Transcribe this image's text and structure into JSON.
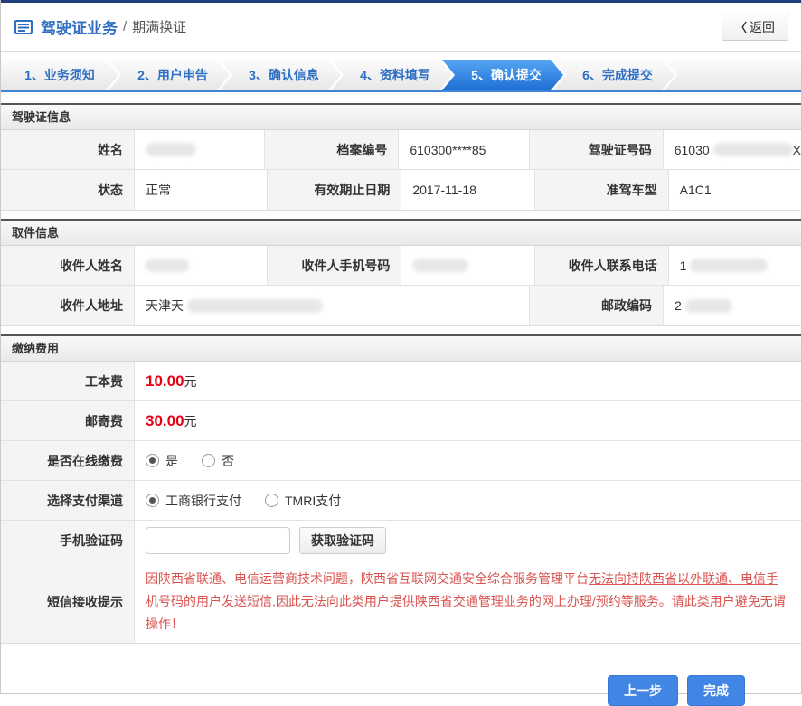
{
  "header": {
    "title": "驾驶证业务",
    "separator": "/",
    "subtitle": "期满换证",
    "back_icon": "〈",
    "back_label": "返回"
  },
  "steps": [
    {
      "label": "1、业务须知",
      "active": false
    },
    {
      "label": "2、用户申告",
      "active": false
    },
    {
      "label": "3、确认信息",
      "active": false
    },
    {
      "label": "4、资料填写",
      "active": false
    },
    {
      "label": "5、确认提交",
      "active": true
    },
    {
      "label": "6、完成提交",
      "active": false
    }
  ],
  "sections": {
    "license": {
      "title": "驾驶证信息",
      "rows": [
        [
          {
            "label": "姓名",
            "value": "",
            "redacted": true
          },
          {
            "label": "档案编号",
            "value": "610300****85"
          },
          {
            "label": "驾驶证号码",
            "value_prefix": "61030",
            "value_suffix": "X",
            "redacted": true
          }
        ],
        [
          {
            "label": "状态",
            "value": "正常"
          },
          {
            "label": "有效期止日期",
            "value": "2017-11-18"
          },
          {
            "label": "准驾车型",
            "value": "A1C1"
          }
        ]
      ]
    },
    "pickup": {
      "title": "取件信息",
      "row1": [
        {
          "label": "收件人姓名",
          "value": "",
          "redacted": true
        },
        {
          "label": "收件人手机号码",
          "value": "",
          "redacted": true
        },
        {
          "label": "收件人联系电话",
          "value_prefix": "1",
          "redacted": true
        }
      ],
      "row2": [
        {
          "label": "收件人地址",
          "value_prefix": "天津天",
          "redacted": true
        },
        {
          "label": "邮政编码",
          "value_prefix": "2",
          "redacted": true
        }
      ]
    },
    "payment": {
      "title": "缴纳费用",
      "fees": [
        {
          "label": "工本费",
          "amount": "10.00",
          "unit": "元"
        },
        {
          "label": "邮寄费",
          "amount": "30.00",
          "unit": "元"
        }
      ],
      "online": {
        "label": "是否在线缴费",
        "options": [
          {
            "label": "是",
            "selected": true
          },
          {
            "label": "否",
            "selected": false
          }
        ]
      },
      "channel": {
        "label": "选择支付渠道",
        "options": [
          {
            "label": "工商银行支付",
            "selected": true
          },
          {
            "label": "TMRI支付",
            "selected": false
          }
        ]
      },
      "sms": {
        "label": "手机验证码",
        "input_value": "",
        "button_label": "获取验证码"
      },
      "notice": {
        "label": "短信接收提示",
        "text_before": "因陕西省联通、电信运营商技术问题，陕西省互联网交通安全综合服务管理平台",
        "text_underlined": "无法向持陕西省以外联通、电信手机号码的用户发送短信",
        "text_after": ",因此无法向此类用户提供陕西省交通管理业务的网上办理/预约等服务。请此类用户避免无谓操作！"
      }
    }
  },
  "footer": {
    "prev_label": "上一步",
    "finish_label": "完成"
  },
  "colors": {
    "accent_blue": "#2d6fc4",
    "active_step_blue": "#1e6fd4",
    "fee_red": "#e60012",
    "notice_red": "#d9534f",
    "top_bar_navy": "#22407c"
  }
}
